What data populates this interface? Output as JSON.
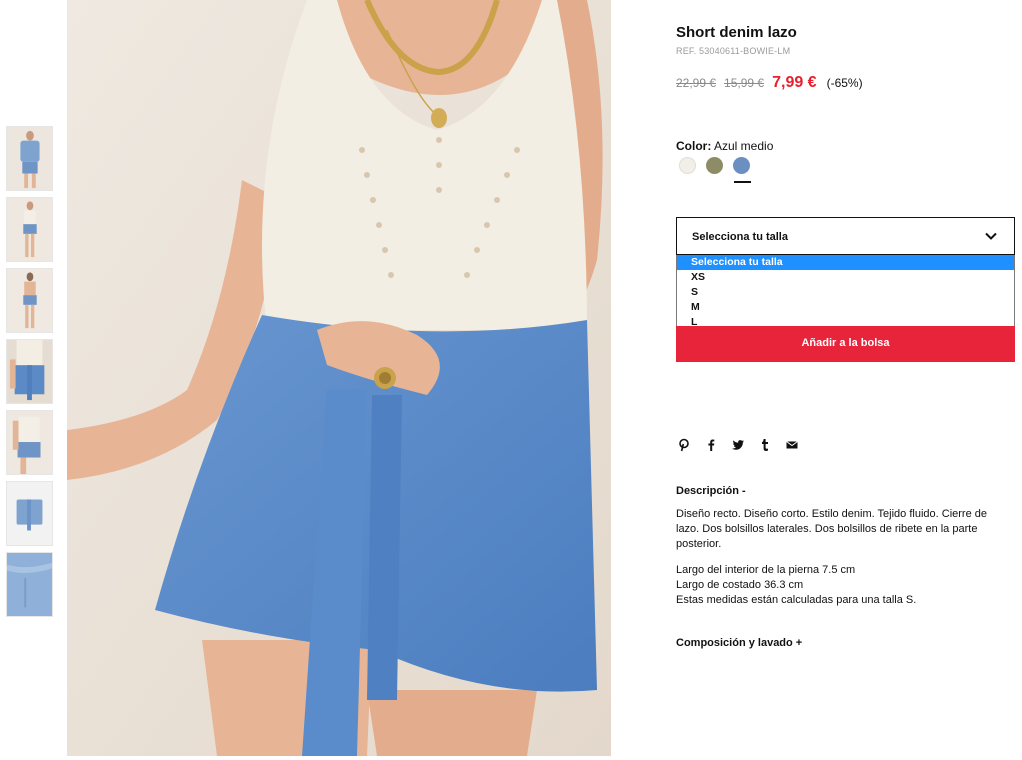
{
  "product": {
    "title": "Short denim lazo",
    "ref": "REF. 53040611-BOWIE-LM",
    "price_original": "22,99 €",
    "price_previous": "15,99 €",
    "price_sale": "7,99 €",
    "discount": "(-65%)"
  },
  "color": {
    "label": "Color:",
    "value": "Azul medio",
    "swatches": [
      {
        "name": "white",
        "hex": "#f2efe9"
      },
      {
        "name": "khaki",
        "hex": "#8e8c66"
      },
      {
        "name": "blue",
        "hex": "#6b8fc2"
      }
    ],
    "selected_index": 2
  },
  "size": {
    "placeholder": "Selecciona tu talla",
    "options": [
      "Selecciona tu talla",
      "XS",
      "S",
      "M",
      "L"
    ],
    "highlighted": "Selecciona tu talla"
  },
  "add_to_bag": "Añadir a la bolsa",
  "share_icons": [
    "pinterest-icon",
    "facebook-icon",
    "twitter-icon",
    "tumblr-icon",
    "mail-icon"
  ],
  "description": {
    "title": "Descripción -",
    "text": "Diseño recto. Diseño corto. Estilo denim. Tejido fluido. Cierre de lazo. Dos bolsillos laterales. Dos bolsillos de ribete en la parte posterior.",
    "measures": [
      "Largo del interior de la pierna 7.5 cm",
      "Largo de costado 36.3 cm",
      "Estas medidas están calculadas para una talla S."
    ]
  },
  "composition_title": "Composición y lavado +",
  "colors": {
    "sale_red": "#e8202e",
    "button_red": "#e8243a",
    "highlight_blue": "#1e90ff",
    "denim": "#5b8ac6",
    "knit": "#f3eee3",
    "skin": "#e7b596"
  },
  "thumbnails": [
    "thumb-full-look-jacket",
    "thumb-full-body",
    "thumb-back",
    "thumb-top-shorts",
    "thumb-side",
    "thumb-flat-shorts",
    "thumb-fabric-detail"
  ]
}
